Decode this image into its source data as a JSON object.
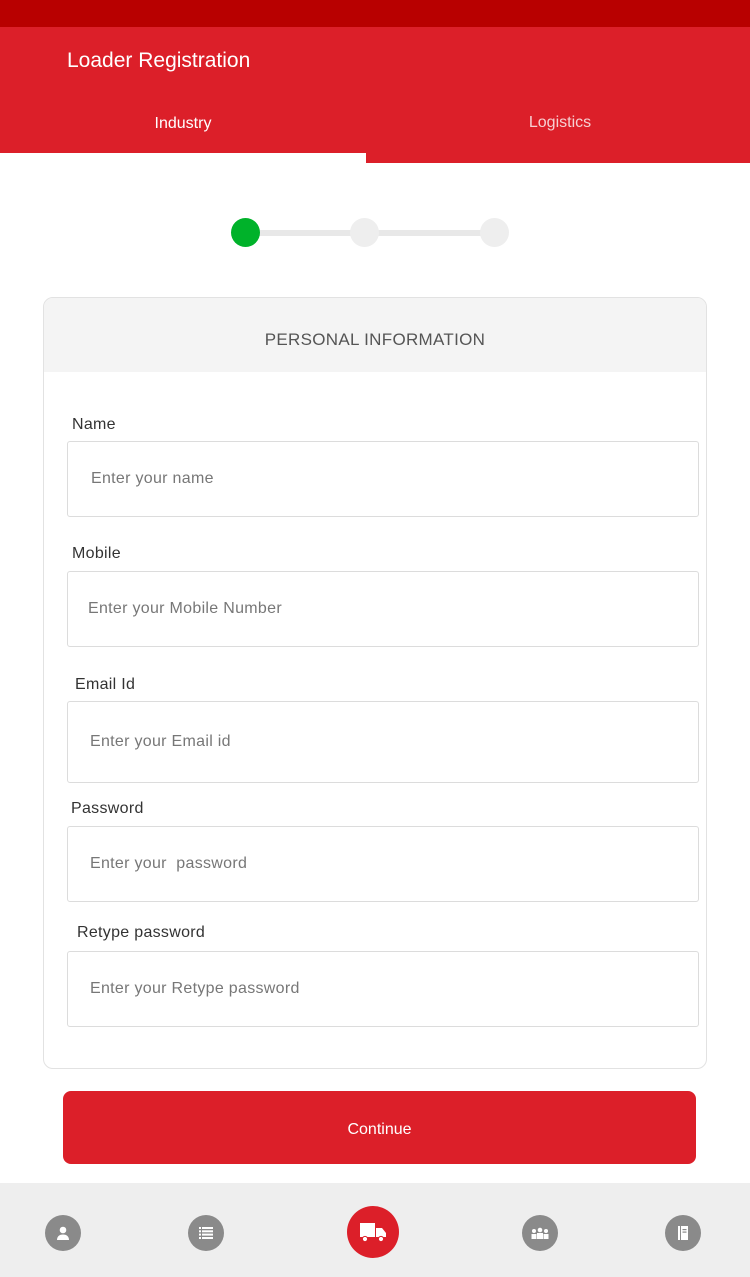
{
  "header": {
    "title": "Loader Registration"
  },
  "tabs": [
    {
      "label": "Industry",
      "active": true
    },
    {
      "label": "Logistics",
      "active": false
    }
  ],
  "stepper": {
    "current_step": 1,
    "total_steps": 3,
    "active_color": "#00b22a"
  },
  "card": {
    "title": "PERSONAL INFORMATION",
    "fields": [
      {
        "label": "Name",
        "placeholder": "Enter your name"
      },
      {
        "label": "Mobile",
        "placeholder": "Enter your Mobile Number"
      },
      {
        "label": "Email Id",
        "placeholder": "Enter your Email id"
      },
      {
        "label": "Password",
        "placeholder": "Enter your  password"
      },
      {
        "label": "Retype password",
        "placeholder": "Enter your Retype password"
      }
    ]
  },
  "continue_label": "Continue",
  "bottom_nav": [
    {
      "icon": "person-icon"
    },
    {
      "icon": "list-icon"
    },
    {
      "icon": "truck-icon",
      "active": true
    },
    {
      "icon": "group-icon"
    },
    {
      "icon": "notebook-icon"
    }
  ],
  "colors": {
    "brand": "#dc1f29",
    "status_bar": "#b80000"
  }
}
